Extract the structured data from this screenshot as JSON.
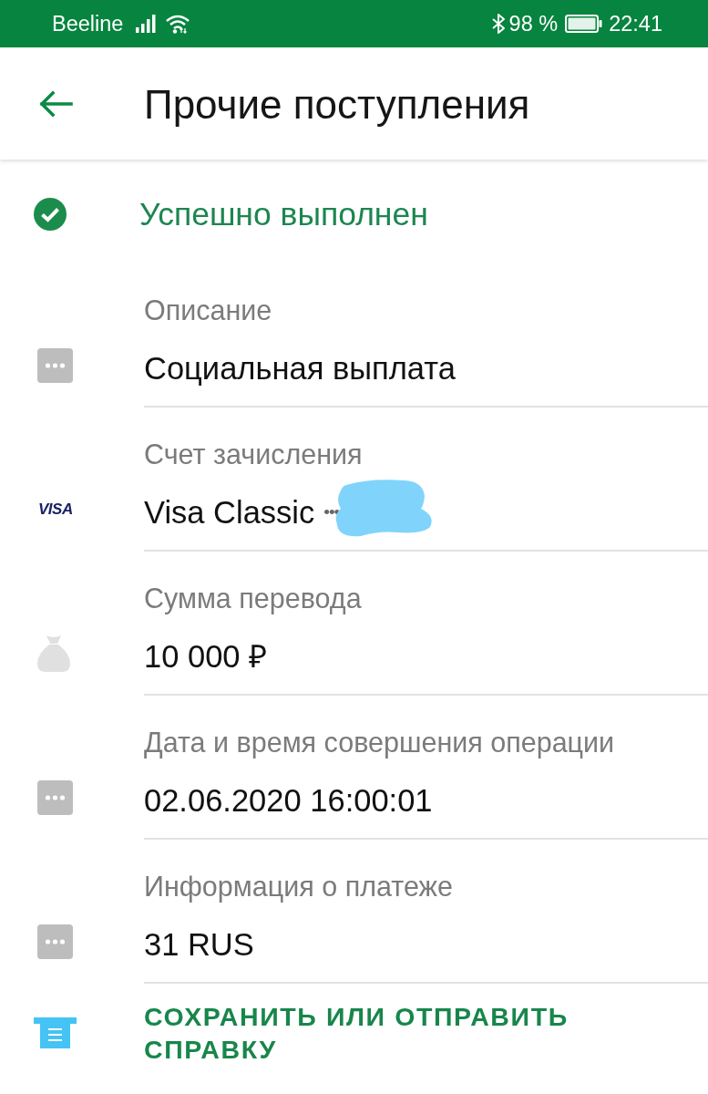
{
  "status_bar": {
    "carrier": "Beeline",
    "battery": "98 %",
    "time": "22:41"
  },
  "app_bar": {
    "title": "Прочие поступления"
  },
  "status": {
    "kind": "success",
    "text": "Успешно выполнен"
  },
  "fields": [
    {
      "kind": "dots",
      "label": "Описание",
      "value": "Социальная выплата"
    },
    {
      "kind": "card",
      "icon_text": "VISA",
      "label": "Счет зачисления",
      "value": "Visa Classic",
      "number_mask": "•••",
      "redacted": true
    },
    {
      "kind": "bag",
      "label": "Сумма перевода",
      "value": "10 000 ₽"
    },
    {
      "kind": "dots",
      "label": "Дата и время совершения операции",
      "value": "02.06.2020 16:00:01"
    },
    {
      "kind": "dots",
      "label": "Информация о платеже",
      "value": "31 RUS"
    }
  ],
  "action": {
    "kind": "receipt",
    "label": "СОХРАНИТЬ ИЛИ ОТПРАВИТЬ СПРАВКУ"
  }
}
